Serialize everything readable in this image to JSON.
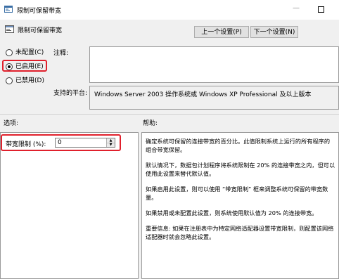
{
  "window": {
    "title": "限制可保留带宽",
    "title_icon": "policy-icon"
  },
  "header": {
    "title": "限制可保留带宽",
    "prev_label": "上一个设置(P)",
    "next_label": "下一个设置(N)"
  },
  "radios": {
    "not_configured": "未配置(C)",
    "enabled": "已启用(E)",
    "disabled": "已禁用(D)",
    "selected": "enabled"
  },
  "comment": {
    "label": "注释:",
    "value": ""
  },
  "supported": {
    "label": "支持的平台:",
    "value": "Windows Server 2003 操作系统或 Windows XP Professional 及以上版本"
  },
  "options": {
    "label": "选项:",
    "bandwidth_label": "带宽限制 (%):",
    "bandwidth_value": "0"
  },
  "help": {
    "label": "帮助:",
    "paragraphs": [
      "确定系统可保留的连接带宽的百分比。此值限制系统上运行的所有程序的组合带宽保留。",
      "默认情况下，数据包计划程序将系统限制在 20% 的连接带宽之内，但可以使用此设置来替代默认值。",
      "如果启用此设置，则可以使用 “带宽限制” 框来调整系统可保留的带宽数量。",
      "如果禁用或未配置此设置，则系统使用默认值为 20% 的连接带宽。",
      "重要信息: 如果在注册表中为特定网络适配器设置带宽限制，则配置该网络适配器时就会忽略此设置。"
    ]
  },
  "colors": {
    "highlight": "#e0202c",
    "window_bg": "#f0f0f0"
  }
}
